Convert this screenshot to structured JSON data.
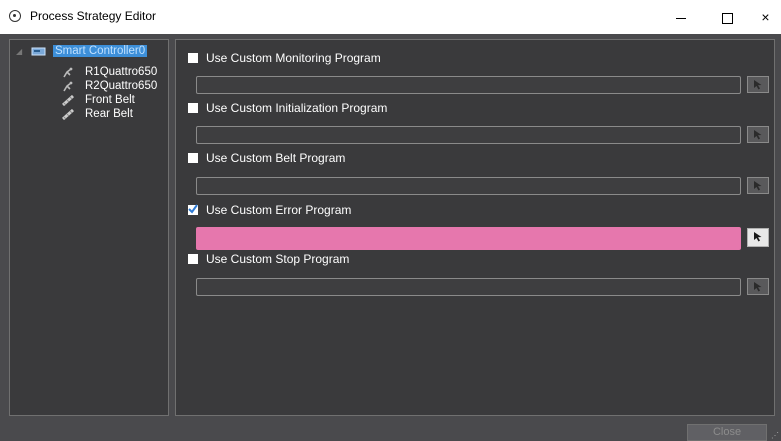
{
  "window": {
    "title": "Process Strategy Editor",
    "minimize_icon": "minimize-icon",
    "maximize_icon": "maximize-icon",
    "close_glyph": "×"
  },
  "tree": {
    "root": {
      "label": "Smart Controller0",
      "icon": "controller-icon",
      "selected": true,
      "selection_color": "#3d8fd9"
    },
    "children": [
      {
        "label": "R1Quattro650",
        "icon": "robot-icon"
      },
      {
        "label": "R2Quattro650",
        "icon": "robot-icon"
      },
      {
        "label": "Front Belt",
        "icon": "belt-icon"
      },
      {
        "label": "Rear Belt",
        "icon": "belt-icon"
      }
    ]
  },
  "options": [
    {
      "label": "Use Custom Monitoring Program",
      "checked": false,
      "value": ""
    },
    {
      "label": "Use Custom Initialization Program",
      "checked": false,
      "value": ""
    },
    {
      "label": "Use Custom Belt Program",
      "checked": false,
      "value": ""
    },
    {
      "label": "Use Custom Error Program",
      "checked": true,
      "value": "",
      "highlight_color": "#e677ad"
    },
    {
      "label": "Use Custom Stop Program",
      "checked": false,
      "value": ""
    }
  ],
  "footer": {
    "close_label": "Close"
  }
}
